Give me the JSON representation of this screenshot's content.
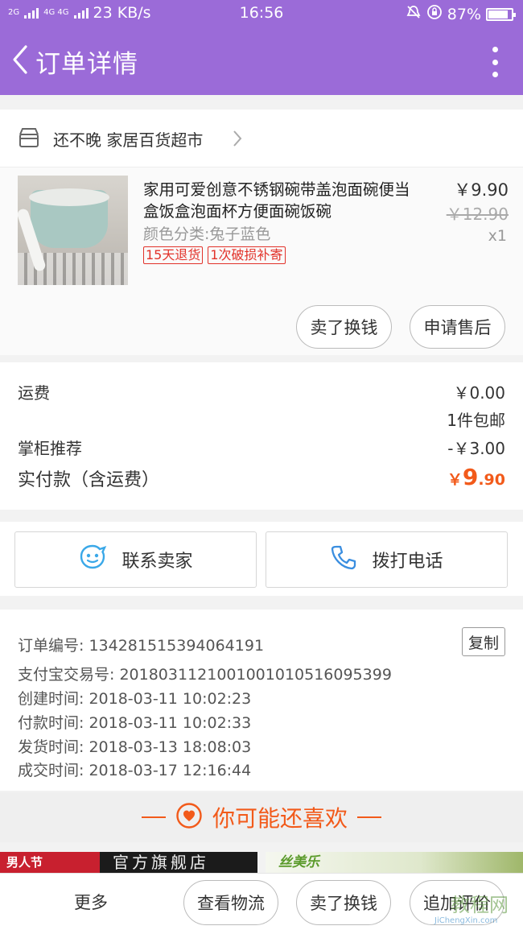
{
  "status_bar": {
    "signal_left": "2G",
    "signal_mid": "4G 4G",
    "speed": "23 KB/s",
    "time": "16:56",
    "battery": "87%"
  },
  "header": {
    "title": "订单详情",
    "bg_color": "#9b6bd8"
  },
  "shop": {
    "name": "还不晚 家居百货超市"
  },
  "product": {
    "name": "家用可爱创意不锈钢碗带盖泡面碗便当盒饭盒泡面杯方便面碗饭碗",
    "attribute": "颜色分类:兔子蓝色",
    "tags": [
      "15天退货",
      "1次破损补寄"
    ],
    "price": "￥9.90",
    "original_price": "￥12.90",
    "quantity": "x1",
    "actions": [
      "卖了换钱",
      "申请售后"
    ]
  },
  "fees": {
    "shipping_label": "运费",
    "shipping_value": "￥0.00",
    "shipping_note": "1件包邮",
    "discount_label": "掌柜推荐",
    "discount_value": "-￥3.00",
    "total_label": "实付款（含运费）",
    "total_currency": "￥",
    "total_int": "9",
    "total_dec": ".90",
    "accent": "#f25a1a"
  },
  "contact": {
    "seller": "联系卖家",
    "phone": "拨打电话"
  },
  "order_info": {
    "order_no": "订单编号: 134281515394064191",
    "copy": "复制",
    "alipay_no": "支付宝交易号: 2018031121001001010516095399",
    "created": "创建时间: 2018-03-11 10:02:23",
    "paid": "付款时间: 2018-03-11 10:02:33",
    "shipped": "发货时间: 2018-03-13 18:08:03",
    "completed": "成交时间: 2018-03-17 12:16:44"
  },
  "recommend": {
    "title": "你可能还喜欢",
    "banner_left_logo": "男人节",
    "banner_left_text": "官方旗舰店",
    "banner_right_logo": "丝美乐"
  },
  "bottom_bar": {
    "more": "更多",
    "logistics": "查看物流",
    "sell": "卖了换钱",
    "review": "追加评价"
  },
  "watermark": {
    "text": "教程网",
    "url": "JiChengXin.com"
  }
}
